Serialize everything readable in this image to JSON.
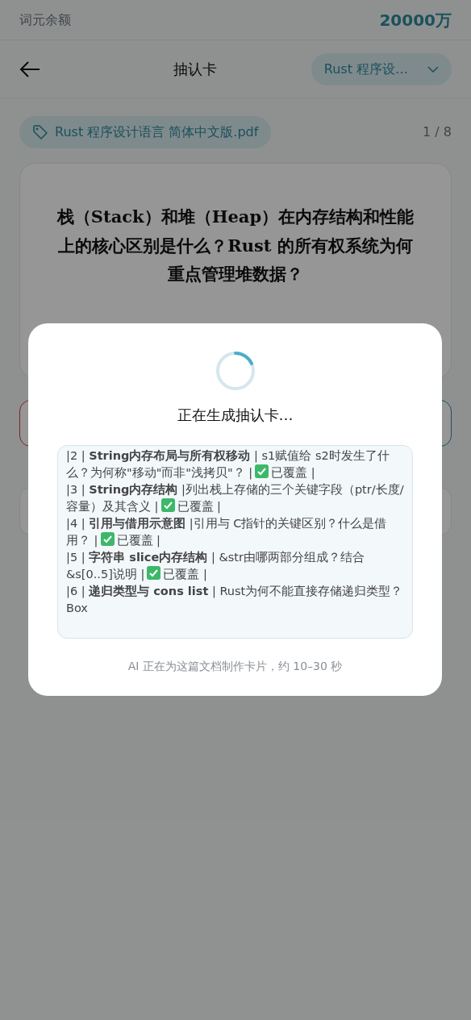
{
  "balance": {
    "label": "词元余额",
    "value": "20000万"
  },
  "header": {
    "title": "抽认卡",
    "document_selector": "Rust 程序设…"
  },
  "source": {
    "file": "Rust 程序设计语言 简体中文版.pdf",
    "progress": "1 / 8"
  },
  "question": "栈（Stack）和堆（Heap）在内存结构和性能上的核心区别是什么？Rust 的所有权系统为何重点管理堆数据？",
  "answer_buttons": [
    {
      "kind": "danger"
    },
    {
      "kind": "primary"
    }
  ],
  "modal": {
    "title": "正在生成抽认卡…",
    "stream": [
      {
        "lead": "|2 | **String内存布局与所有权移动** | s1赋值给 s2时发生了什么？为何称\"移动\"而非\"浅拷贝\"？ |",
        "covered": true,
        "status": "已覆盖 |"
      },
      {
        "lead": "|3 | **String内存结构** |列出栈上存储的三个关键字段（ptr/长度/容量）及其含义 |",
        "covered": true,
        "status": "已覆盖 |"
      },
      {
        "lead": "|4 | **引用与借用示意图** |引用与 C指针的关键区别？什么是借用？ |",
        "covered": true,
        "status": "已覆盖 |"
      },
      {
        "lead": "|5 | **字符串 slice内存结构** | &str由哪两部分组成？结合 &s[0..5]说明 |",
        "covered": true,
        "status": "已覆盖 |"
      },
      {
        "lead": "|6 | **递归类型与 cons list** | Rust为何不能直接存储递归类型？Box",
        "covered": false
      }
    ],
    "note": "AI 正在为这篇文档制作卡片，约 10–30 秒"
  }
}
